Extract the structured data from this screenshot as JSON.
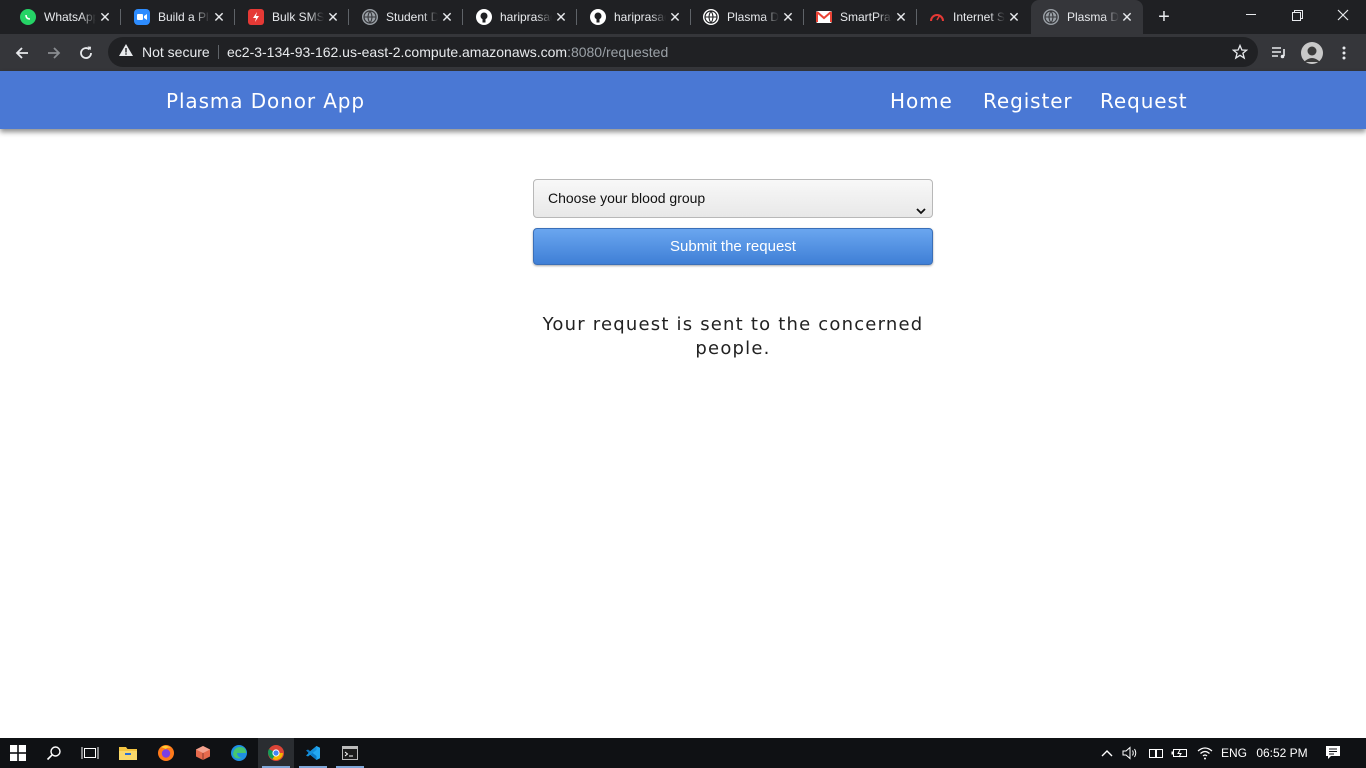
{
  "browser": {
    "tabs": [
      {
        "title": "WhatsApp",
        "icon": "whatsapp-icon",
        "color": "#25d366"
      },
      {
        "title": "Build a Plasma",
        "icon": "zoom-icon",
        "color": "#2d8cff"
      },
      {
        "title": "Bulk SMS",
        "icon": "fast2sms-icon",
        "color": "#e53935"
      },
      {
        "title": "Student Dashboard",
        "icon": "globe-icon",
        "color": "#9aa0a6"
      },
      {
        "title": "hariprasad",
        "icon": "github-icon",
        "color": "#ffffff"
      },
      {
        "title": "hariprasad",
        "icon": "github-icon",
        "color": "#ffffff"
      },
      {
        "title": "Plasma Donor",
        "icon": "globe-icon",
        "color": "#ffffff"
      },
      {
        "title": "SmartPrakash",
        "icon": "gmail-icon",
        "color": "#ea4335"
      },
      {
        "title": "Internet Speed",
        "icon": "speedtest-icon",
        "color": "#e53935"
      },
      {
        "title": "Plasma Donor App",
        "icon": "globe-icon",
        "color": "#9aa0a6",
        "active": true
      }
    ],
    "security_label": "Not secure",
    "url_host": "ec2-3-134-93-162.us-east-2.compute.amazonaws.com",
    "url_rest": ":8080/requested"
  },
  "app": {
    "brand": "Plasma Donor App",
    "nav": {
      "home": "Home",
      "register": "Register",
      "request": "Request"
    },
    "colors": {
      "navbar": "#4a78d4",
      "button": "#3f7fd6"
    }
  },
  "form": {
    "blood_group_select": {
      "selected": "Choose your blood group"
    },
    "submit_label": "Submit the request"
  },
  "message": "Your request is sent to the concerned people.",
  "taskbar": {
    "language": "ENG",
    "time": "06:52 PM"
  }
}
